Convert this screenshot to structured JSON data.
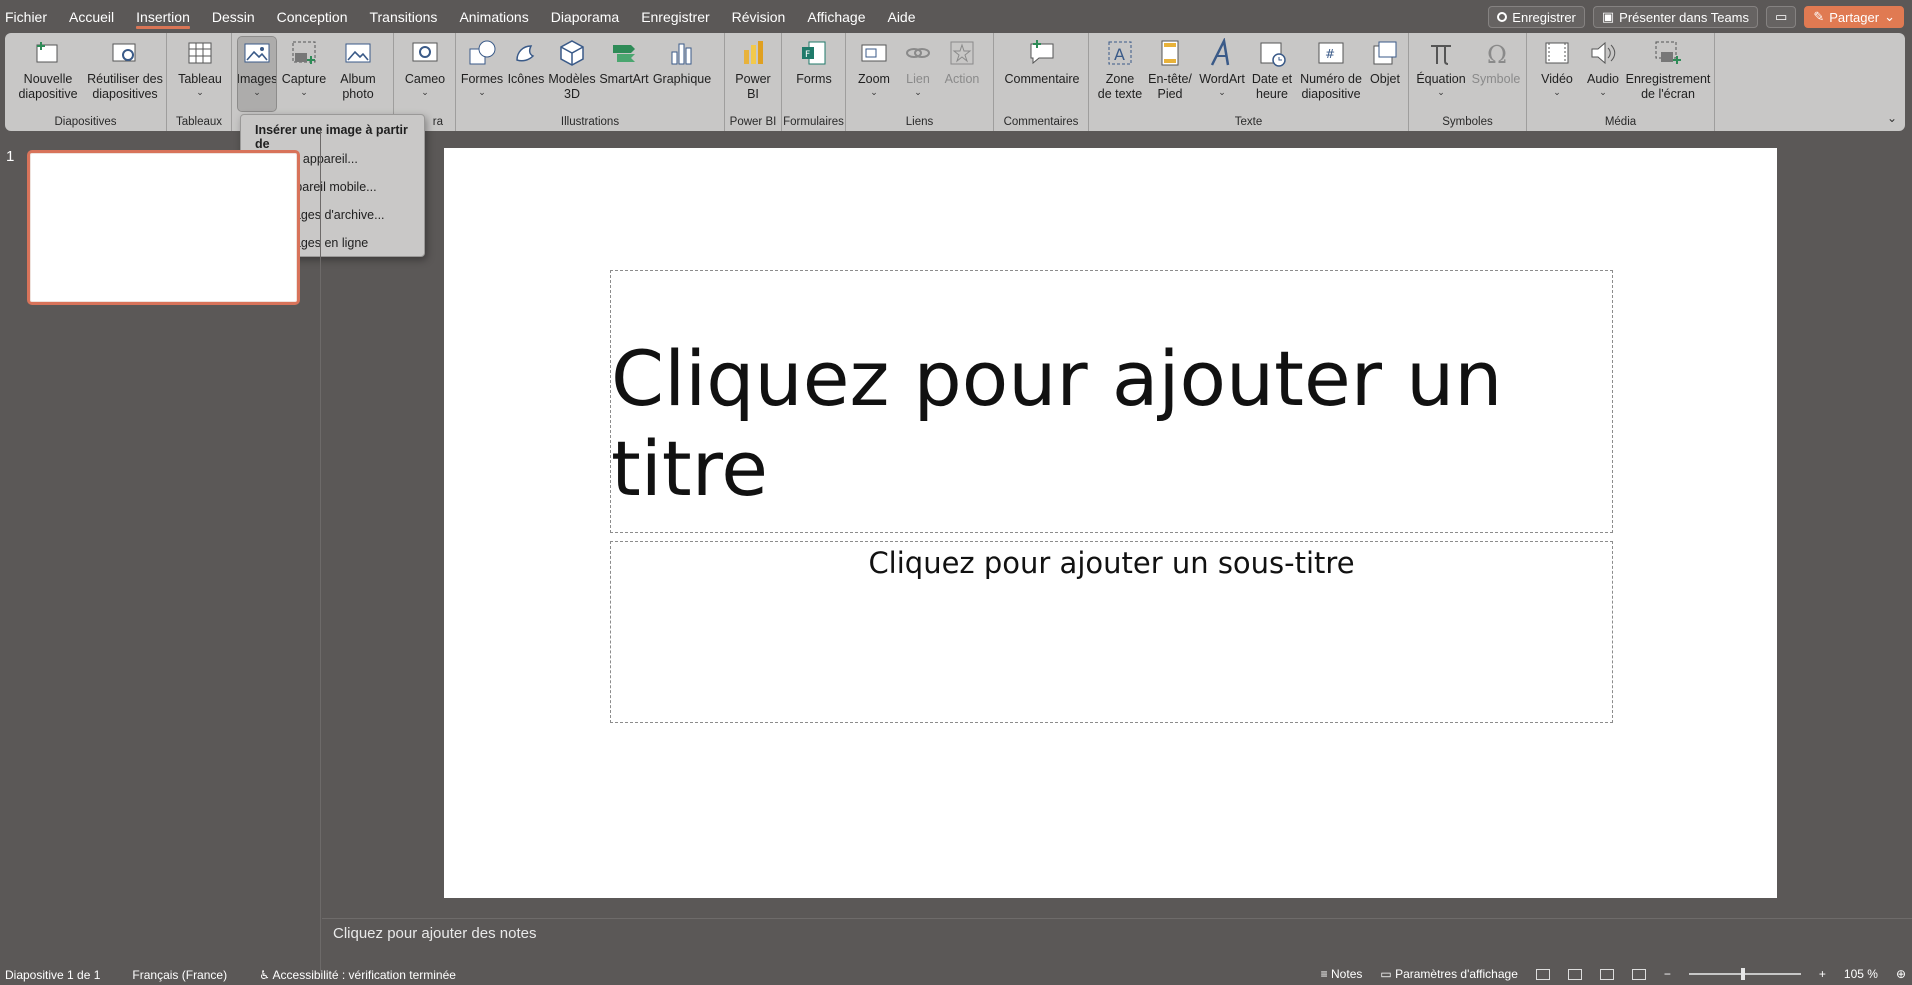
{
  "menubar": {
    "tabs": [
      "Fichier",
      "Accueil",
      "Insertion",
      "Dessin",
      "Conception",
      "Transitions",
      "Animations",
      "Diaporama",
      "Enregistrer",
      "Révision",
      "Affichage",
      "Aide"
    ],
    "active_tab": "Insertion",
    "record_label": "Enregistrer",
    "teams_label": "Présenter dans Teams",
    "share_label": "Partager"
  },
  "ribbon": {
    "groups": {
      "diapositives": "Diapositives",
      "tableaux": "Tableaux",
      "illustrations": "Illustrations",
      "powerbi": "Power BI",
      "formulaires": "Formulaires",
      "liens": "Liens",
      "commentaires": "Commentaires",
      "texte": "Texte",
      "symboles": "Symboles",
      "media": "Média",
      "cameo_partial": "ra"
    },
    "buttons": {
      "new_slide": [
        "Nouvelle",
        "diapositive"
      ],
      "reuse": [
        "Réutiliser des",
        "diapositives"
      ],
      "table": "Tableau",
      "images": "Images",
      "capture": "Capture",
      "album": [
        "Album",
        "photo"
      ],
      "cameo": "Cameo",
      "shapes": "Formes",
      "icons": "Icônes",
      "models3d": [
        "Modèles",
        "3D"
      ],
      "smartart": "SmartArt",
      "chart": "Graphique",
      "powerbi": [
        "Power",
        "BI"
      ],
      "forms": "Forms",
      "zoom": "Zoom",
      "link": "Lien",
      "action": "Action",
      "comment": "Commentaire",
      "textbox": [
        "Zone",
        "de texte"
      ],
      "header": [
        "En-tête/",
        "Pied"
      ],
      "wordart": "WordArt",
      "datetime": [
        "Date et",
        "heure"
      ],
      "slide_number": [
        "Numéro de",
        "diapositive"
      ],
      "object": "Objet",
      "equation": "Équation",
      "symbol": "Symbole",
      "video": "Vidéo",
      "audio": "Audio",
      "screen_record": [
        "Enregistrement",
        "de l'écran"
      ]
    }
  },
  "dropdown": {
    "title": "Insérer une image à partir de",
    "items": [
      "Cet appareil...",
      "Appareil mobile...",
      "Images d'archive...",
      "Images en ligne"
    ]
  },
  "thumbnails": {
    "number": "1"
  },
  "slide": {
    "title_placeholder": "Cliquez pour ajouter un titre",
    "subtitle_placeholder": "Cliquez pour ajouter un sous-titre"
  },
  "notes": {
    "placeholder": "Cliquez pour ajouter des notes"
  },
  "status": {
    "slide_info": "Diapositive 1 de 1",
    "language": "Français (France)",
    "accessibility": "Accessibilité : vérification terminée",
    "notes": "Notes",
    "display_settings": "Paramètres d'affichage",
    "zoom": "105 %"
  },
  "colors": {
    "accent": "#d97556",
    "ribbon": "#c8c7c6",
    "background": "#5b5857"
  }
}
